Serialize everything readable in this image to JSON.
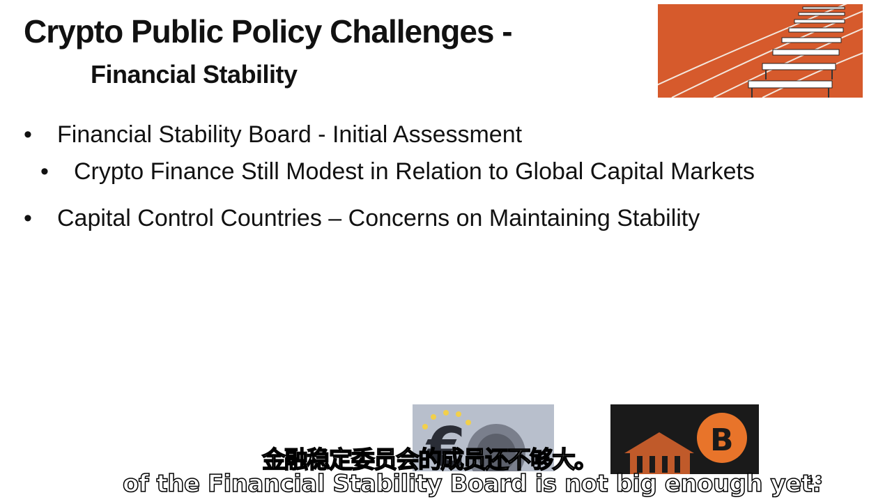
{
  "slide": {
    "title": "Crypto Public Policy Challenges -",
    "subtitle": "Financial Stability",
    "bullet_char": "•",
    "bullets": [
      {
        "text": "Financial Stability Board - Initial Assessment"
      },
      {
        "text": "Crypto Finance Still Modest in Relation to Global Capital Markets"
      },
      {
        "text": "Capital Control Countries – Concerns on Maintaining Stability"
      }
    ],
    "page_number": "13"
  },
  "captions": {
    "chinese": "金融稳定委员会的成员还不够大。",
    "english": "of the Financial Stability Board is not big enough yet."
  },
  "colors": {
    "track_orange": "#d65a2c",
    "bitcoin_orange": "#e8742a"
  },
  "images": [
    {
      "name": "hurdles-track-image"
    },
    {
      "name": "euro-sign-image"
    },
    {
      "name": "bitcoin-bank-image"
    }
  ]
}
